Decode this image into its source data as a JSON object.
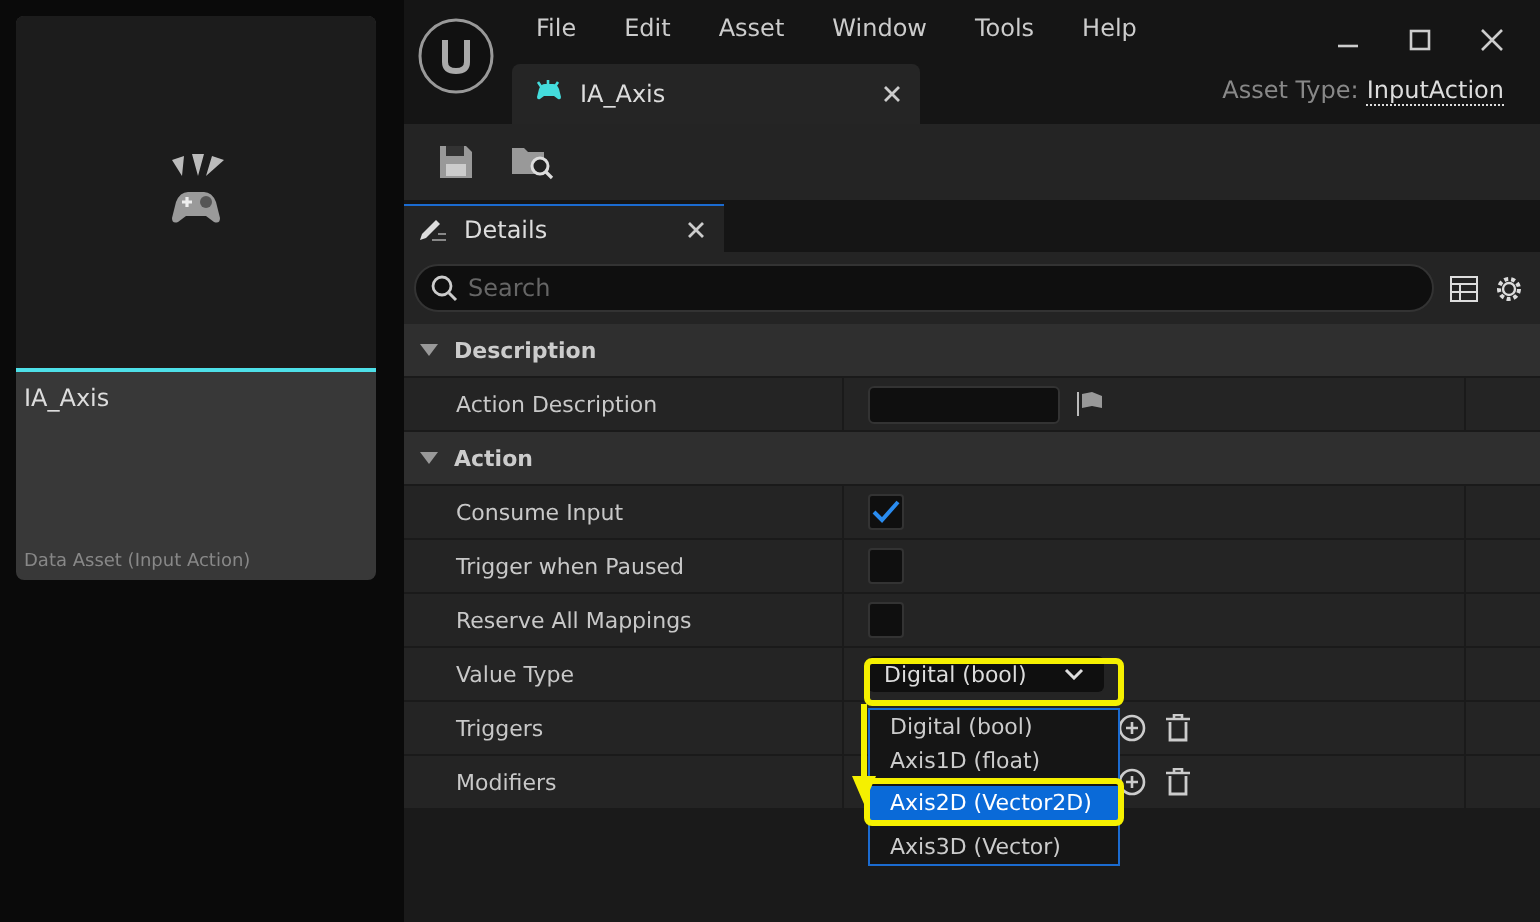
{
  "asset_card": {
    "name": "IA_Axis",
    "type": "Data Asset (Input Action)"
  },
  "menu": [
    "File",
    "Edit",
    "Asset",
    "Window",
    "Tools",
    "Help"
  ],
  "document_tab": {
    "label": "IA_Axis"
  },
  "asset_type": {
    "label": "Asset Type:",
    "value": "InputAction"
  },
  "details_tab": {
    "label": "Details"
  },
  "search": {
    "placeholder": "Search"
  },
  "sections": [
    {
      "title": "Description",
      "expanded": true,
      "rows": [
        {
          "kind": "text",
          "label": "Action Description"
        }
      ]
    },
    {
      "title": "Action",
      "expanded": true,
      "rows": [
        {
          "kind": "checkbox",
          "label": "Consume Input",
          "checked": true
        },
        {
          "kind": "checkbox",
          "label": "Trigger when Paused",
          "checked": false
        },
        {
          "kind": "checkbox",
          "label": "Reserve All Mappings",
          "checked": false
        },
        {
          "kind": "combo",
          "label": "Value Type",
          "value": "Digital (bool)"
        },
        {
          "kind": "array",
          "label": "Triggers"
        },
        {
          "kind": "array",
          "label": "Modifiers"
        }
      ]
    }
  ],
  "dropdown_options": [
    {
      "label": "Digital (bool)",
      "selected": false
    },
    {
      "label": "Axis1D (float)",
      "selected": false
    },
    {
      "label": "Axis2D (Vector2D)",
      "selected": true
    },
    {
      "label": "Axis3D (Vector)",
      "selected": false
    }
  ]
}
